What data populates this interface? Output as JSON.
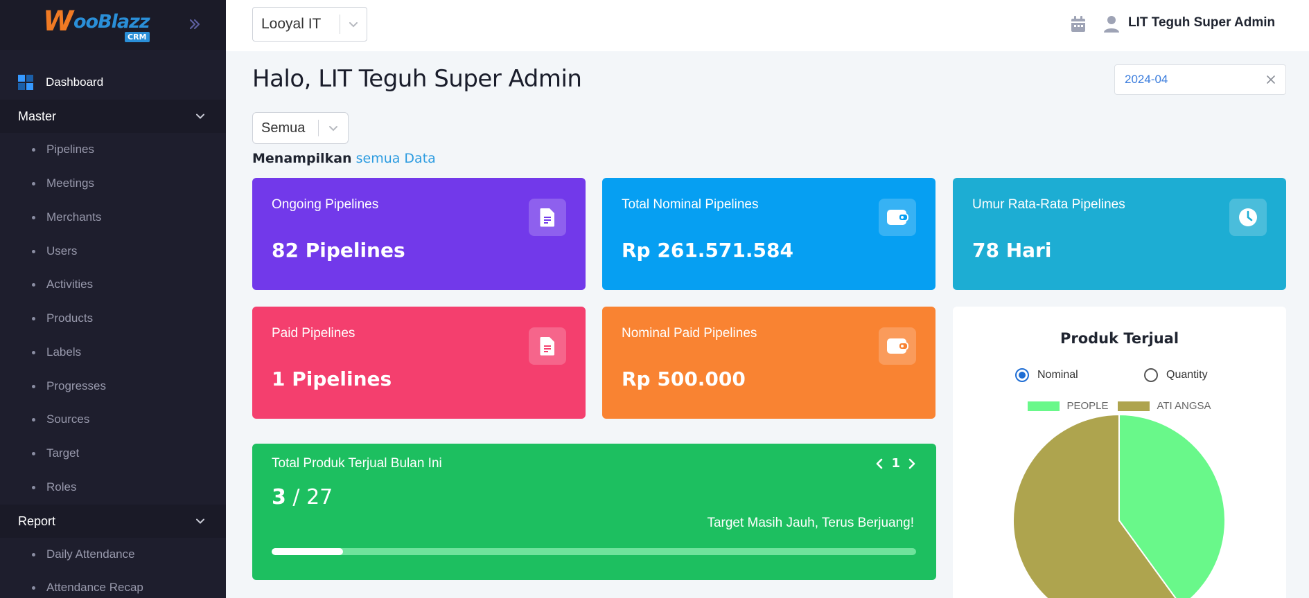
{
  "colors": {
    "sidebar_bg": "#1e1e2d",
    "accent_blue": "#2b9be0",
    "card_purple": "#7239ea",
    "card_blue": "#069ff2",
    "card_cyan": "#1dadd3",
    "card_pink": "#f43f6e",
    "card_orange": "#f98332",
    "card_green": "#1dbf60"
  },
  "brand": {
    "logo_text": "ooBlazz",
    "logo_badge": "CRM"
  },
  "sidebar": {
    "dashboard_label": "Dashboard",
    "master": {
      "label": "Master",
      "items": [
        "Pipelines",
        "Meetings",
        "Merchants",
        "Users",
        "Activities",
        "Products",
        "Labels",
        "Progresses",
        "Sources",
        "Target",
        "Roles"
      ]
    },
    "report": {
      "label": "Report",
      "items": [
        "Daily Attendance",
        "Attendance Recap"
      ]
    }
  },
  "topbar": {
    "company_value": "Looyal IT",
    "user_name": "LIT Teguh Super Admin"
  },
  "main": {
    "greeting": "Halo, LIT Teguh Super Admin",
    "date_value": "2024-04",
    "scope_value": "Semua",
    "showing_prefix": "Menampilkan",
    "showing_link": "semua Data"
  },
  "cards": [
    {
      "title": "Ongoing Pipelines",
      "value": "82 Pipelines",
      "icon": "document-icon"
    },
    {
      "title": "Total Nominal Pipelines",
      "value": "Rp 261.571.584",
      "icon": "wallet-icon"
    },
    {
      "title": "Umur Rata-Rata Pipelines",
      "value": "78 Hari",
      "icon": "clock-icon"
    },
    {
      "title": "Paid Pipelines",
      "value": "1 Pipelines",
      "icon": "document-icon"
    },
    {
      "title": "Nominal Paid Pipelines",
      "value": "Rp 500.000",
      "icon": "wallet-icon"
    }
  ],
  "product_card": {
    "title": "Total Produk Terjual Bulan Ini",
    "sold": "3",
    "separator": "/",
    "target": "27",
    "message": "Target Masih Jauh, Terus Berjuang!",
    "page": "1",
    "progress_fraction": 0.111
  },
  "pie": {
    "title": "Produk Terjual",
    "radio_nominal": "Nominal",
    "radio_quantity": "Quantity",
    "selected": "Nominal"
  },
  "chart_data": {
    "type": "pie",
    "title": "Produk Terjual",
    "labels": [
      "PEOPLE",
      "ATI ANGSA"
    ],
    "values": [
      40,
      60
    ],
    "colors": [
      "#69f88a",
      "#aea44e"
    ]
  }
}
